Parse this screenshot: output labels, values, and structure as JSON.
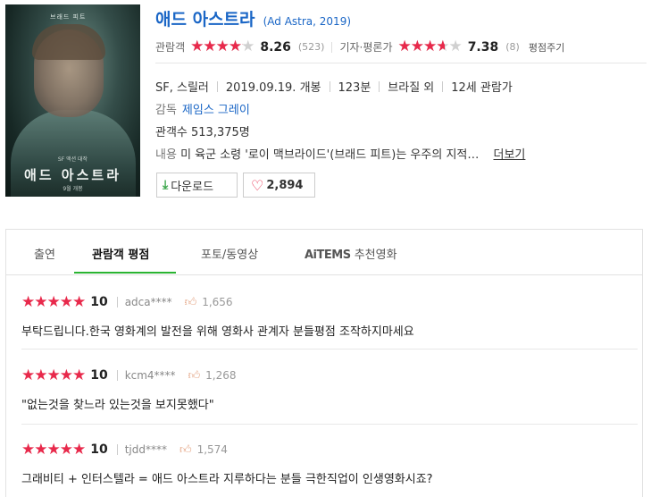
{
  "poster": {
    "top_text": "브래드 피트",
    "title_text": "애드 아스트라",
    "sub_text": "SF 액션 대작",
    "sub2_text": "9월 개봉"
  },
  "movie": {
    "title": "애드 아스트라",
    "original": "(Ad Astra, 2019)"
  },
  "ratings": {
    "audience_label": "관람객",
    "audience_score": "8.26",
    "audience_fraction": 0.826,
    "audience_count": "(523)",
    "critic_label": "기자·평론가",
    "critic_score": "7.38",
    "critic_fraction": 0.738,
    "critic_count": "(8)",
    "rate_link": "평점주기"
  },
  "meta": {
    "genre": "SF, 스릴러",
    "release": "2019.09.19. 개봉",
    "runtime": "123분",
    "country": "브라질 외",
    "age": "12세 관람가",
    "director_label": "감독",
    "director": "제임스 그레이",
    "audience_count_text": "관객수 513,375명",
    "plot_label": "내용",
    "plot": "미 육군 소령 '로이 맥브라이드'(브래드 피트)는 우주의 지적…",
    "more": "더보기"
  },
  "buttons": {
    "download": "다운로드",
    "likes": "2,894"
  },
  "tabs": {
    "cast": "출연",
    "reviews": "관람객 평점",
    "photos": "포토/동영상",
    "aitems": "AiTEMS",
    "recommend": "추천영화"
  },
  "reviews": [
    {
      "stars": "★★★★★",
      "score": "10",
      "user": "adca****",
      "likes": "1,656",
      "text": "부탁드립니다.한국 영화계의 발전을 위해 영화사 관계자 분들평점 조작하지마세요"
    },
    {
      "stars": "★★★★★",
      "score": "10",
      "user": "kcm4****",
      "likes": "1,268",
      "text": "\"없는것을 찾느라 있는것을 보지못했다\""
    },
    {
      "stars": "★★★★★",
      "score": "10",
      "user": "tjdd****",
      "likes": "1,574",
      "text": "그래비티 + 인터스텔라 = 애드 아스트라 지루하다는 분들 극한직업이 인생영화시죠?"
    }
  ],
  "colors": {
    "accent_blue": "#1a66c6",
    "star_red": "#e8294b",
    "tab_green": "#2ab432"
  }
}
